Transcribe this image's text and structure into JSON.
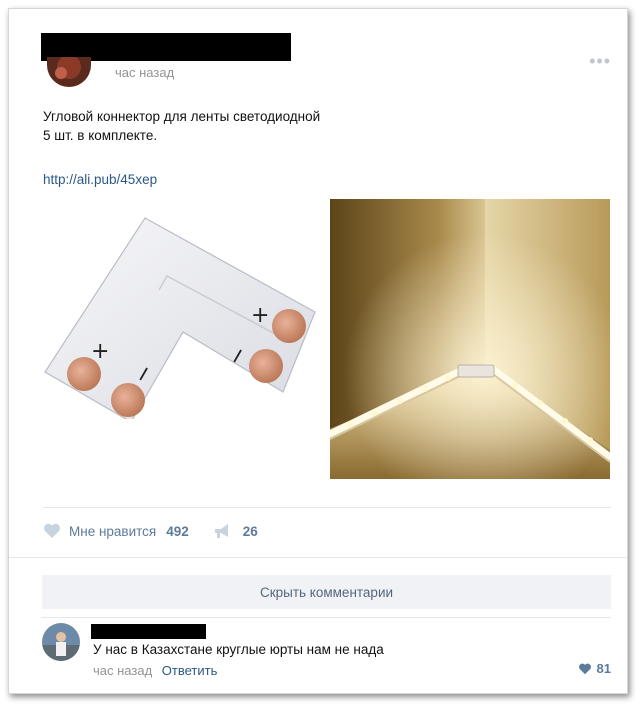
{
  "post": {
    "time": "час назад",
    "text_line1": "Угловой коннектор для ленты светодиодной",
    "text_line2": "5 шт. в комплекте.",
    "link": "http://ali.pub/45xep",
    "connector_plus_1": "+",
    "connector_plus_2": "+",
    "connector_minus_1": "−",
    "connector_minus_2": "−",
    "likes_label": "Мне нравится",
    "likes_count": "492",
    "shares_count": "26"
  },
  "comments": {
    "hide_label": "Скрыть комментарии",
    "comment": {
      "text": "У нас в Казахстане круглые юрты нам не нада",
      "time": "час назад",
      "reply_label": "Ответить",
      "likes": "81"
    }
  },
  "colors": {
    "link": "#2a5885",
    "muted": "#939393",
    "action": "#5c7a99",
    "button_bg": "#f0f2f5"
  }
}
